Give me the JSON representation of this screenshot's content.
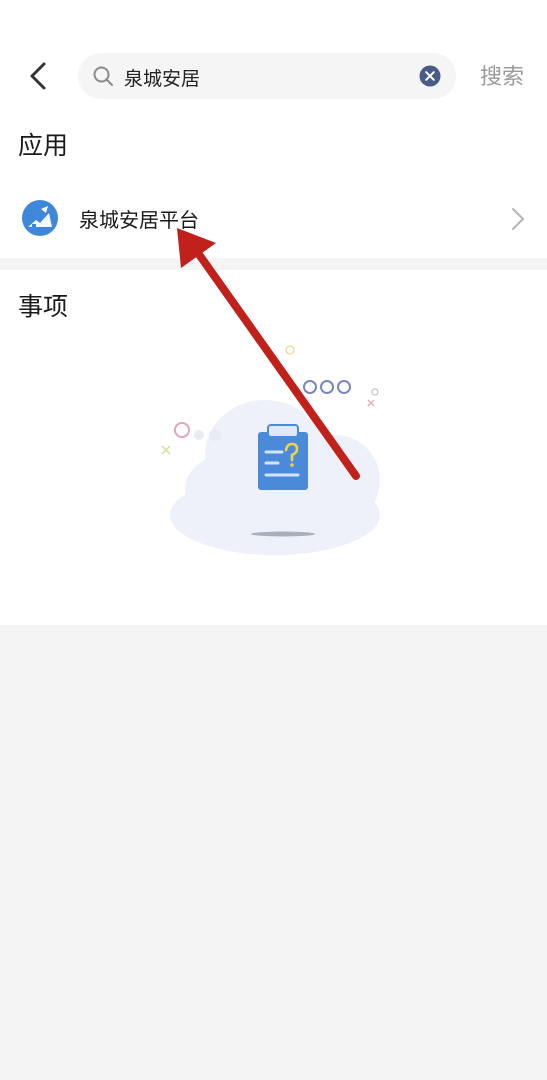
{
  "search": {
    "query": "泉城安居",
    "action_label": "搜索"
  },
  "sections": {
    "apps_title": "应用",
    "items_title": "事项"
  },
  "apps": [
    {
      "name": "泉城安居平台",
      "icon": "house-logo-icon"
    }
  ],
  "icons": {
    "back": "chevron-left-icon",
    "search": "search-icon",
    "clear": "clear-icon",
    "row_arrow": "chevron-right-icon",
    "empty_state": "clipboard-question-icon"
  },
  "colors": {
    "accent_blue": "#3f87d8",
    "annotation_red": "#c1211b",
    "page_bg": "#f4f4f5"
  }
}
